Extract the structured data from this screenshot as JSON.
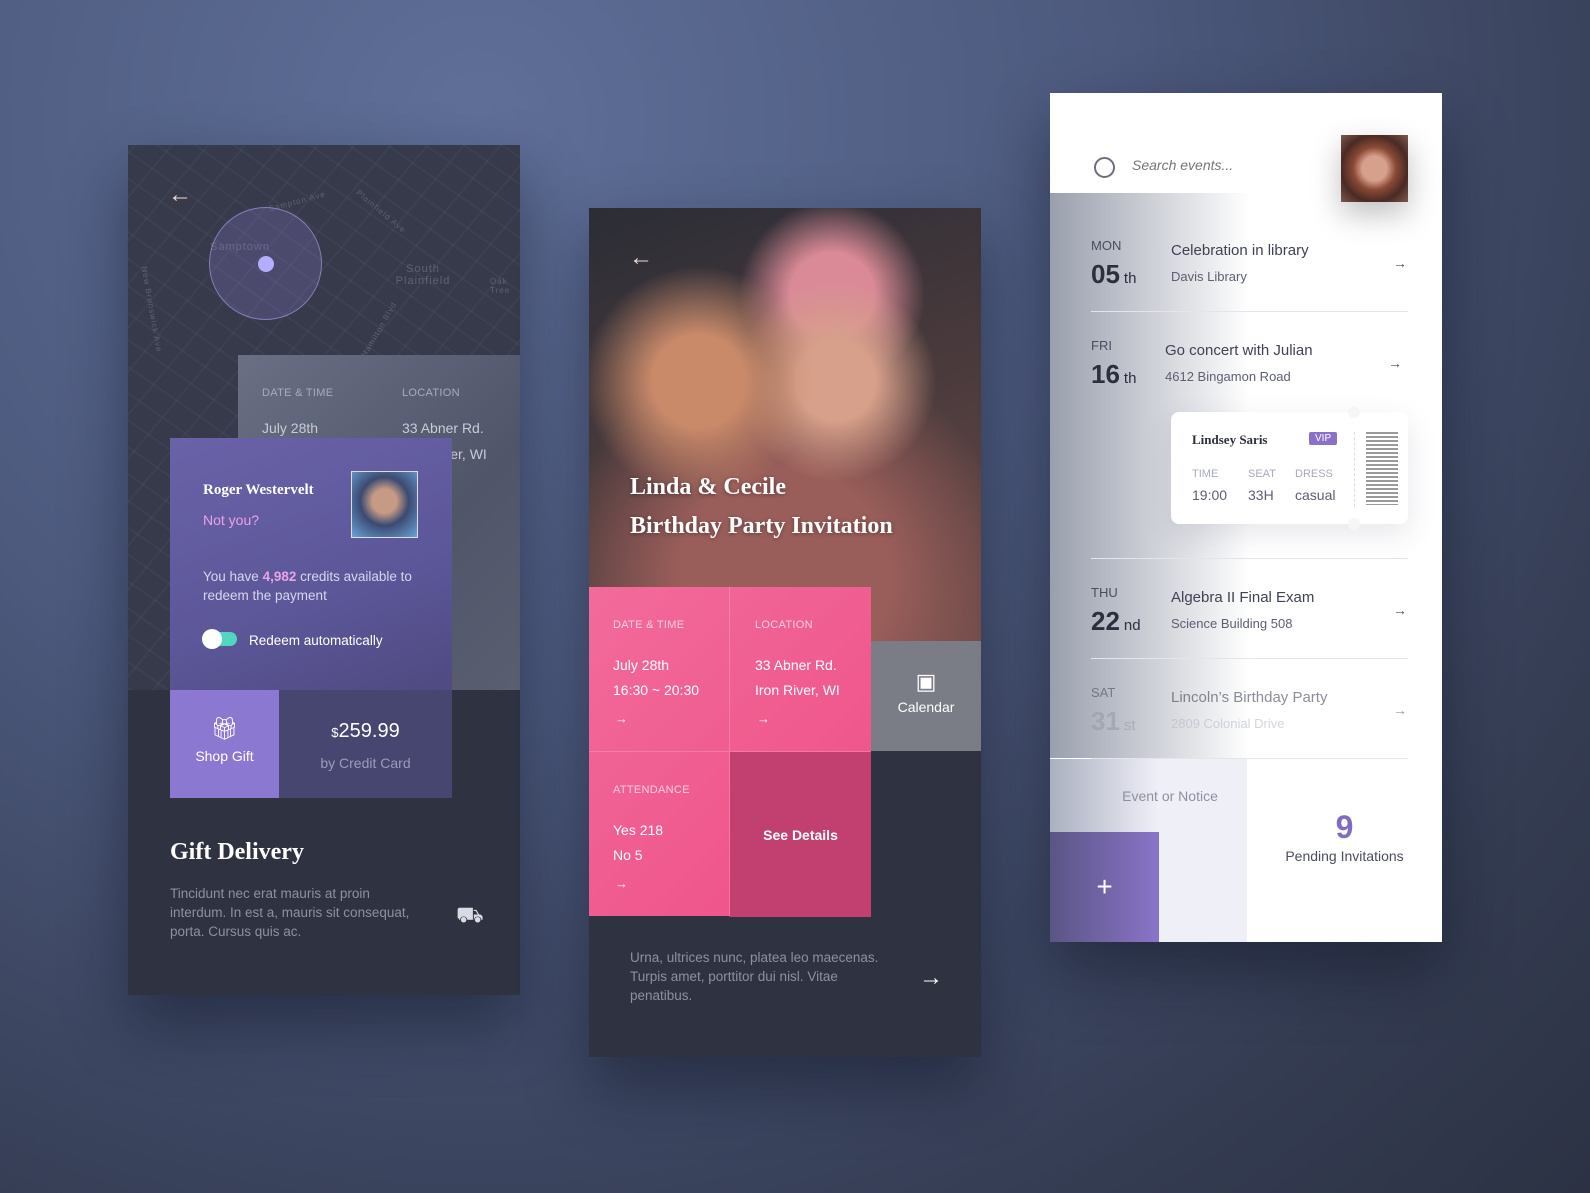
{
  "gift_screen": {
    "map_labels": [
      "Samptown",
      "South Plainfield",
      "Sampton Ave",
      "Plainfield Ave",
      "New Brunswick Ave",
      "Hamilton Blvd",
      "Oak Tree"
    ],
    "event_info": {
      "date_label": "DATE & TIME",
      "location_label": "LOCATION",
      "date": "July 28th",
      "location_line1": "33 Abner Rd.",
      "location_line2": "Iron River, WI"
    },
    "user": {
      "name": "Roger Westervelt",
      "not_you": "Not you?"
    },
    "credits": {
      "prefix": "You have ",
      "amount": "4,982",
      "suffix": " credits available to redeem the payment"
    },
    "toggle": {
      "label": "Redeem automatically",
      "on": true
    },
    "shop_gift": "Shop Gift",
    "price": {
      "currency": "$",
      "amount": "259.99",
      "method": "by Credit Card"
    },
    "title": "Gift Delivery",
    "description": "Tincidunt nec erat mauris at proin interdum. In est a, mauris sit consequat, porta. Cursus quis ac.",
    "colors": {
      "accent": "#8b78d0",
      "highlight": "#e9a3e6"
    }
  },
  "invitation_screen": {
    "title_line1": "Linda & Cecile",
    "title_line2": "Birthday Party Invitation",
    "date_time": {
      "label": "DATE & TIME",
      "line1": "July 28th",
      "line2": "16:30 ~ 20:30"
    },
    "location": {
      "label": "LOCATION",
      "line1": "33 Abner Rd.",
      "line2": "Iron River, WI"
    },
    "calendar": "Calendar",
    "attendance": {
      "label": "ATTENDANCE",
      "yes": "Yes 218",
      "no": "No 5"
    },
    "see_details": "See Details",
    "footer_text": "Urna, ultrices nunc, platea leo maecenas. Turpis amet, porttitor dui nisl. Vitae penatibus.",
    "colors": {
      "pink": "#f0578e",
      "dark_pink": "#c2406f"
    }
  },
  "events_screen": {
    "search_placeholder": "Search events...",
    "events": [
      {
        "day": "MON",
        "date": "05",
        "suffix": "th",
        "title": "Celebration in library",
        "subtitle": "Davis Library"
      },
      {
        "day": "FRI",
        "date": "16",
        "suffix": "th",
        "title": "Go concert with Julian",
        "subtitle": "4612 Bingamon Road"
      },
      {
        "day": "THU",
        "date": "22",
        "suffix": "nd",
        "title": "Algebra II Final Exam",
        "subtitle": "Science Building 508"
      },
      {
        "day": "SAT",
        "date": "31",
        "suffix": "st",
        "title": "Lincoln’s Birthday Party",
        "subtitle": "2809 Colonial Drive"
      }
    ],
    "ticket": {
      "name": "Lindsey Saris",
      "badge": "VIP",
      "time_label": "TIME",
      "time": "19:00",
      "seat_label": "SEAT",
      "seat": "33H",
      "dress_label": "DRESS",
      "dress": "casual"
    },
    "new_label": "Event or Notice",
    "pending_count": "9",
    "pending_label": "Pending Invitations",
    "colors": {
      "accent": "#7f6bc2"
    }
  }
}
